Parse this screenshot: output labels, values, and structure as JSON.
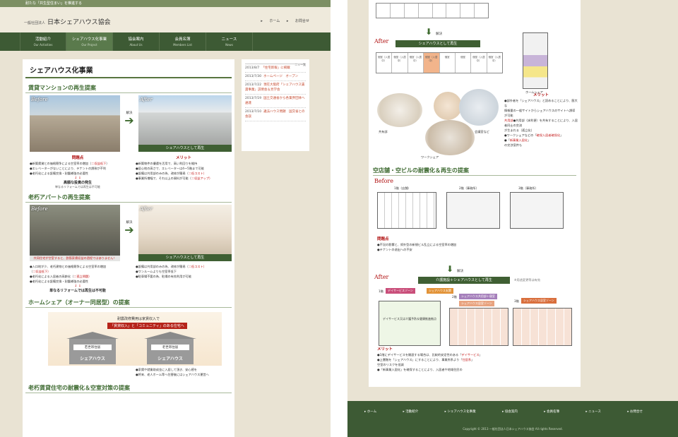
{
  "left": {
    "topbar": "耐たな「共生型住まい」を推進する",
    "header": {
      "org_prefix": "一般社団法人",
      "org_name": "日本シェアハウス協会",
      "links": [
        "ホーム",
        "お問合せ"
      ]
    },
    "nav": [
      {
        "jp": "活動紹介",
        "en": "Our Activities"
      },
      {
        "jp": "シェアハウス化事業",
        "en": "Our Project"
      },
      {
        "jp": "協会案内",
        "en": "About Us"
      },
      {
        "jp": "会員名簿",
        "en": "Members List"
      },
      {
        "jp": "ニュース",
        "en": "News"
      }
    ],
    "page_title": "シェアハウス化事業",
    "section1": {
      "title": "賃貸マンションの再生提案",
      "before": "Before",
      "after": "After",
      "arrow": "解決",
      "regen": "シェアハウスとして再生",
      "problems_title": "問題点",
      "problems": [
        "●新築賃貸との価格競争による空室率の増加（",
        "●エレベーターがないことにより、テナントの誘致が不利",
        "●老朽化による設備交換・耐震補強の必要性"
      ],
      "problems_red": [
        "＝収益低下"
      ],
      "down": "↓ ↓",
      "result": "高額な投資の発生",
      "result_sub": "単なるリフォームでは再生は不可能",
      "merit_title": "メリット",
      "merits": [
        "●新築物件の優遇を活用で、高い利回りを維持",
        "●居心地の高さで、エレベーターは4～5階まで可能",
        "●設備は共用部のみの為、改修が簡易（",
        "●事業所増幅で、それ以上の資料が可能（"
      ],
      "merits_red": [
        "＝低コスト）",
        "＝収益アップ）"
      ]
    },
    "section2": {
      "title": "老朽アパートの再生提案",
      "before": "Before",
      "after": "After",
      "arrow": "解決",
      "regen": "シェアハウスとして再生",
      "caption": "共同住宅が空室すると、鉄筋家賃収益の過程ではありません！",
      "problems": [
        "●入口地が少、老朽建物との価格競争による空室率の増加（",
        "●老朽化による入居者の高齢化（",
        "●老朽化による設備交換・耐震補強の必要性"
      ],
      "problems_red": [
        "＝収益低下）",
        "＝孤立問題）"
      ],
      "merits": [
        "●設備は共用部のみの為、改修が簡易（",
        "●ワンルームよりも空室率低下",
        "●駐車場不要の為、駐場の有効利用が可能"
      ],
      "merits_red": [
        "＝低コスト）"
      ],
      "down": "↓ ↓",
      "result": "単なるリフォームでは再生は不可能"
    },
    "section3": {
      "title": "ホームシェア（オーナー同居型）の提案",
      "banner_text": "耐震改修費用は家賃収入で",
      "banner_pill": "「賃貸収入」と「コミュニティ」のある住宅へ",
      "house1_label": "若世帯住居",
      "house1_name": "シェアハウス",
      "house2_label": "老世帯住居",
      "house2_name": "シェアハウス",
      "bullets": [
        "●家賃や就業助成金に入居して頂き、安心感を",
        "●将来、老人ホーム等へ住替後にはシェアハウス運営へ"
      ]
    },
    "section4_title": "老朽賃貸住宅の耐震化＆空室対策の提案",
    "news": {
      "title": "ニュース",
      "more": "一覧",
      "items": [
        {
          "date": "2013/8/7",
          "text": "「住宅新報」に掲載"
        },
        {
          "date": "2013/7/30",
          "text": "ホームページ　オープン"
        },
        {
          "date": "2013/7/22",
          "text": "現在大阪府「シェアハウス賃貸事業」説明会＆見学会"
        },
        {
          "date": "2013/7/19",
          "text": "国土交通省から各業界団体へ通達"
        },
        {
          "date": "2013/7/10",
          "text": "違法ハウス問題　国交省との会談"
        }
      ]
    }
  },
  "right": {
    "arrow_label": "解決",
    "after": "After",
    "regen": "シェアハウスとして再生",
    "floorplan_label": "ホームシェア",
    "rooms": [
      "個室（入居中）",
      "個室（入居中）",
      "個室（入居中）",
      "個室（入居中）",
      "個室",
      "個室",
      "個室（入居中）",
      "個室（入居中）",
      "個室"
    ],
    "photo_labels": [
      "共有部",
      "会議室など",
      "ワークシェア"
    ],
    "merit_title": "メリット",
    "merits": [
      "●部外者を「シェアハウス」と読めることにより、膨大な",
      "  情報量の一般サイトからシェアハウスのサイトへ誘導が可能",
      "●共用部（床利便）を共有することにより、入居者同士の交流",
      "  が生まれる（孤立化）",
      "●ワークシェアなどの「",
      "●「",
      "  の交渉案件も"
    ],
    "merits_red": [
      "共用部",
      "確保入居者確保化",
      "新事業入居化"
    ],
    "section_title": "空店舗・空ビルの耐震化＆再生の提案",
    "before": "Before",
    "floors": [
      "1階（店舗）",
      "2階（事務所）",
      "3階（事務所）"
    ],
    "problems_title": "問題点",
    "problems": [
      "●不況の影響と、郊外型の新規ビル乱立による空室率の増加",
      "●テナントの退出への不安"
    ],
    "arrow2": "解決",
    "after2": "After",
    "regen2": "介護施設＋シェアハウスとして再生",
    "regen2_note": "※用途変更等は有効",
    "floor_tags": [
      "1階",
      "2階",
      "3階"
    ],
    "chips": [
      "デイサービスゾーン",
      "シェアハウス玄関",
      "シェアハウス共用部＋寝室",
      "シェアハウス居室ゾーン",
      "シェアハウス居室ゾーン"
    ],
    "dayservice_label": "デイサービス又は介護予防＆健康推進拠点",
    "merits2_title": "メリット",
    "merits2": [
      "●1階にデイサービスを開設する場合は、比較的安定性のある「",
      "●上層階を「シェアハウス」にすることにより、事業所系より",
      "  空室のリスクを低減",
      "●「新事業入居化」を確保することにより、入居者や地域住民の"
    ],
    "merits2_red": [
      "デイサービス",
      "住居系"
    ],
    "footer_links": [
      "ホーム",
      "活動紹介",
      "シェアハウス化事業",
      "協会案内",
      "会員名簿",
      "ニュース",
      "お問合せ"
    ],
    "copyright": "Copyright © 2013 一般社団法人日本シェアハウス協会 All rights Reserved."
  },
  "colors": {
    "nav_green": "#3d5a34",
    "accent_green": "#3f6b32",
    "alert_red": "#c41a1a",
    "page_beige": "#e9e3d3"
  }
}
